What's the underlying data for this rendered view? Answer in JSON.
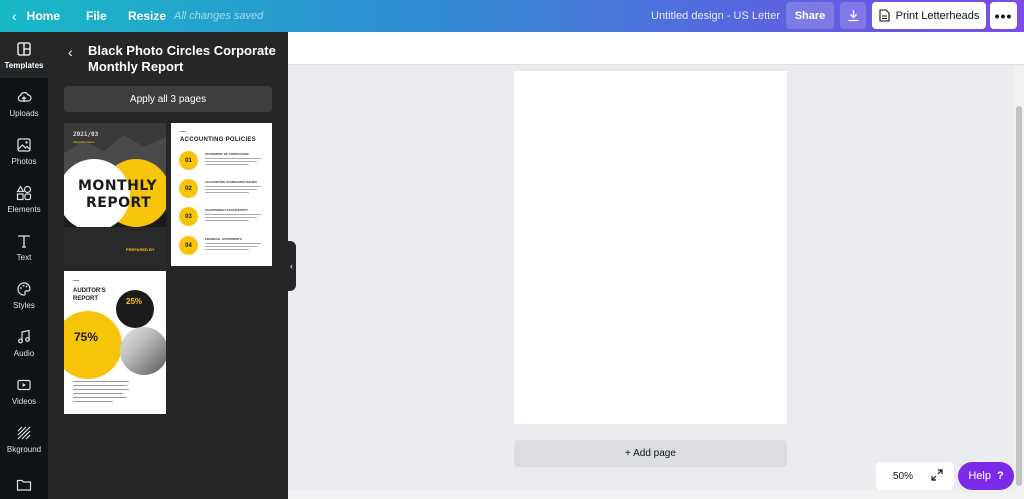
{
  "topbar": {
    "home_label": "Home",
    "file_label": "File",
    "resize_label": "Resize",
    "save_status": "All changes saved",
    "design_title": "Untitled design - US Letter",
    "share_label": "Share",
    "print_label": "Print Letterheads",
    "more_label": "•••"
  },
  "rail": {
    "items": [
      {
        "label": "Templates",
        "icon": "templates-icon"
      },
      {
        "label": "Uploads",
        "icon": "upload-icon"
      },
      {
        "label": "Photos",
        "icon": "photo-icon"
      },
      {
        "label": "Elements",
        "icon": "elements-icon"
      },
      {
        "label": "Text",
        "icon": "text-icon"
      },
      {
        "label": "Styles",
        "icon": "palette-icon"
      },
      {
        "label": "Audio",
        "icon": "music-icon"
      },
      {
        "label": "Videos",
        "icon": "video-icon"
      },
      {
        "label": "Bkground",
        "icon": "background-icon"
      },
      {
        "label": "",
        "icon": "folder-icon"
      }
    ]
  },
  "panel": {
    "title": "Black Photo Circles Corporate Monthly Report",
    "apply_label": "Apply all 3 pages",
    "thumb1": {
      "date": "2021/03",
      "subtitle": "Magazine Name",
      "title_line1": "MONTHLY",
      "title_line2": "REPORT",
      "prepared": "PREPARED BY"
    },
    "thumb2": {
      "heading": "ACCOUNTING POLICIES",
      "rows": [
        {
          "num": "01",
          "label": "STATEMENT OF COMPLIANCE"
        },
        {
          "num": "02",
          "label": "ACCOUNTING STANDARDS ISSUED"
        },
        {
          "num": "03",
          "label": "CHARTERED ACCOUNTANTS"
        },
        {
          "num": "04",
          "label": "FINANCIAL STATEMENTS"
        }
      ]
    },
    "thumb3": {
      "title_line1": "AUDITOR'S",
      "title_line2": "REPORT",
      "pct_small": "25%",
      "pct_large": "75%"
    }
  },
  "canvas": {
    "add_page_label": "+ Add page",
    "zoom": "50%"
  },
  "help": {
    "label": "Help",
    "mark": "?"
  },
  "colors": {
    "accent_purple": "#7d2ae8",
    "template_yellow": "#f6c50a",
    "panel_dark": "#252627",
    "rail_dark": "#0e1318"
  }
}
